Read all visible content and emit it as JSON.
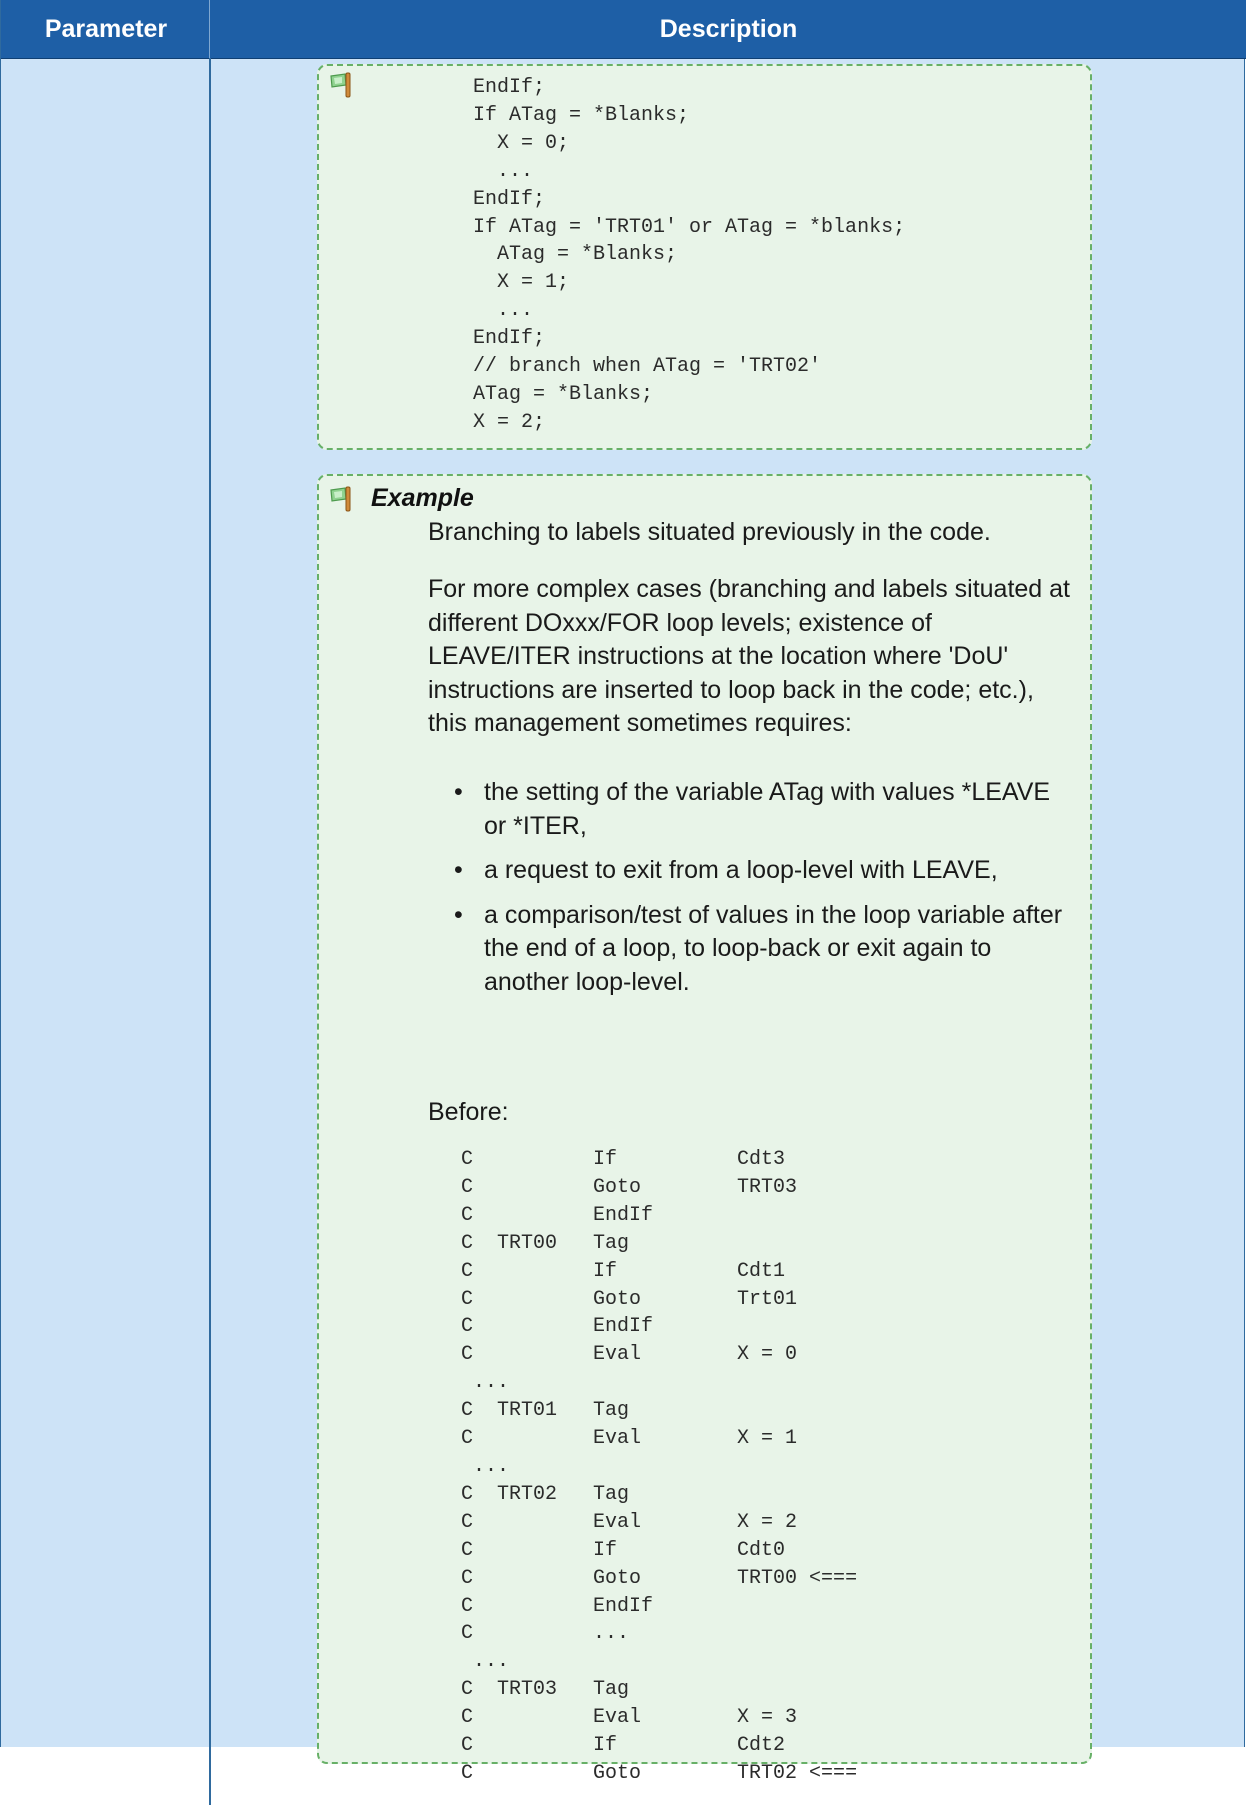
{
  "header": {
    "parameter_label": "Parameter",
    "description_label": "Description"
  },
  "box1": {
    "icon": "note-flag-icon",
    "code": "EndIf;\nIf ATag = *Blanks;\n  X = 0;\n  ...\nEndIf;\nIf ATag = 'TRT01' or ATag = *blanks;\n  ATag = *Blanks;\n  X = 1;\n  ...\nEndIf;\n// branch when ATag = 'TRT02'\nATag = *Blanks;\nX = 2;"
  },
  "example": {
    "icon": "note-flag-icon",
    "title": "Example",
    "intro": "Branching to labels situated previously in the code.",
    "paragraph": "For more complex cases (branching and labels situated at different DOxxx/FOR loop levels; existence of LEAVE/ITER instructions at the location where 'DoU' instructions are inserted to loop back in the code; etc.), this management sometimes requires:",
    "bullets": [
      "the setting of the variable ATag with values *LEAVE or *ITER,",
      "a request to exit from a loop-level with LEAVE,",
      "a comparison/test of values in the loop variable after the end of a loop, to loop-back or exit again to another loop-level."
    ],
    "before_label": "Before:",
    "code": "C          If          Cdt3\nC          Goto        TRT03\nC          EndIf\nC  TRT00   Tag\nC          If          Cdt1\nC          Goto        Trt01\nC          EndIf\nC          Eval        X = 0\n ...\nC  TRT01   Tag\nC          Eval        X = 1\n ...\nC  TRT02   Tag\nC          Eval        X = 2\nC          If          Cdt0\nC          Goto        TRT00 <===\nC          EndIf\nC          ...\n ...\nC  TRT03   Tag\nC          Eval        X = 3\nC          If          Cdt2\nC          Goto        TRT02 <==="
  },
  "colors": {
    "header_bg": "#1e5fa6",
    "cell_bg": "#cde3f7",
    "note_bg": "#e8f4e8",
    "note_border": "#67b067"
  }
}
